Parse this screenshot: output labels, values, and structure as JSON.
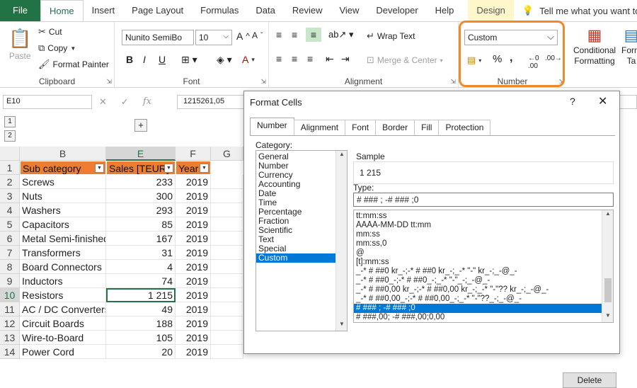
{
  "ribbon_tabs": {
    "file": "File",
    "home": "Home",
    "insert": "Insert",
    "page_layout": "Page Layout",
    "formulas": "Formulas",
    "data": "Data",
    "review": "Review",
    "view": "View",
    "developer": "Developer",
    "help": "Help",
    "design": "Design",
    "tell_me": "Tell me what you want to d"
  },
  "clipboard": {
    "paste": "Paste",
    "cut": "Cut",
    "copy": "Copy",
    "format_painter": "Format Painter",
    "label": "Clipboard"
  },
  "font": {
    "name": "Nunito SemiBo",
    "size": "10",
    "bold": "B",
    "italic": "I",
    "underline": "U",
    "label": "Font"
  },
  "alignment": {
    "wrap_text": "Wrap Text",
    "merge_center": "Merge & Center",
    "label": "Alignment"
  },
  "number": {
    "format": "Custom",
    "percent": "%",
    "comma": ",",
    "label": "Number"
  },
  "styles": {
    "conditional_line1": "Conditional",
    "conditional_line2": "Formatting",
    "format_table_line1": "Form",
    "format_table_line2": "Ta"
  },
  "formula_bar": {
    "name_box": "E10",
    "fx": "fx",
    "value": "1215261,05"
  },
  "outline": {
    "level1": "1",
    "level2": "2",
    "expand": "+"
  },
  "sheet": {
    "columns": [
      "B",
      "E",
      "F",
      "G"
    ],
    "header": {
      "row": "1",
      "b": "Sub category",
      "e": "Sales [TEUR]",
      "f": "Year"
    },
    "rows": [
      {
        "row": "2",
        "b": "Screws",
        "e": "233",
        "f": "2019"
      },
      {
        "row": "3",
        "b": "Nuts",
        "e": "300",
        "f": "2019"
      },
      {
        "row": "4",
        "b": "Washers",
        "e": "293",
        "f": "2019"
      },
      {
        "row": "5",
        "b": "Capacitors",
        "e": "85",
        "f": "2019"
      },
      {
        "row": "6",
        "b": "Metal Semi-finished",
        "e": "167",
        "f": "2019"
      },
      {
        "row": "7",
        "b": "Transformers",
        "e": "31",
        "f": "2019"
      },
      {
        "row": "8",
        "b": "Board Connectors",
        "e": "4",
        "f": "2019"
      },
      {
        "row": "9",
        "b": "Inductors",
        "e": "74",
        "f": "2019"
      },
      {
        "row": "10",
        "b": "Resistors",
        "e": "1 215",
        "f": "2019"
      },
      {
        "row": "11",
        "b": "AC / DC Converters",
        "e": "49",
        "f": "2019"
      },
      {
        "row": "12",
        "b": "Circuit Boards",
        "e": "188",
        "f": "2019"
      },
      {
        "row": "13",
        "b": "Wire-to-Board",
        "e": "105",
        "f": "2019"
      },
      {
        "row": "14",
        "b": "Power Cord",
        "e": "20",
        "f": "2019"
      }
    ]
  },
  "dialog": {
    "title": "Format Cells",
    "help": "?",
    "close": "✕",
    "tabs": [
      "Number",
      "Alignment",
      "Font",
      "Border",
      "Fill",
      "Protection"
    ],
    "category_label": "Category:",
    "categories": [
      "General",
      "Number",
      "Currency",
      "Accounting",
      "Date",
      "Time",
      "Percentage",
      "Fraction",
      "Scientific",
      "Text",
      "Special",
      "Custom"
    ],
    "selected_category": "Custom",
    "sample_label": "Sample",
    "sample_value": "1 215",
    "type_label": "Type:",
    "type_value": "# ### ; -# ### ;0",
    "type_list": [
      "tt:mm:ss",
      "ÅÅÅÅ-MM-DD tt:mm",
      "mm:ss",
      "mm:ss,0",
      "@",
      "[t]:mm:ss",
      "_-* # ##0 kr_-;-* # ##0 kr_-;_-* \"-\" kr_-;_-@_-",
      "_-* # ##0_-;-* # ##0_-;_-* \"-\"_-;_-@_-",
      "_-* # ##0,00 kr_-;-* # ##0,00 kr_-;_-* \"-\"?? kr_-;_-@_-",
      "_-* # ##0,00_-;-* # ##0,00_-;_-* \"-\"??_-;_-@_-",
      "# ### ; -# ### ;0",
      "# ###,00; -# ###,00;0,00"
    ],
    "selected_type_index": 10,
    "delete": "Delete"
  },
  "colors": {
    "excel_green": "#217346",
    "header_orange": "#ED7D31",
    "highlight_orange": "#F0892A",
    "selection_blue": "#0078D7"
  }
}
